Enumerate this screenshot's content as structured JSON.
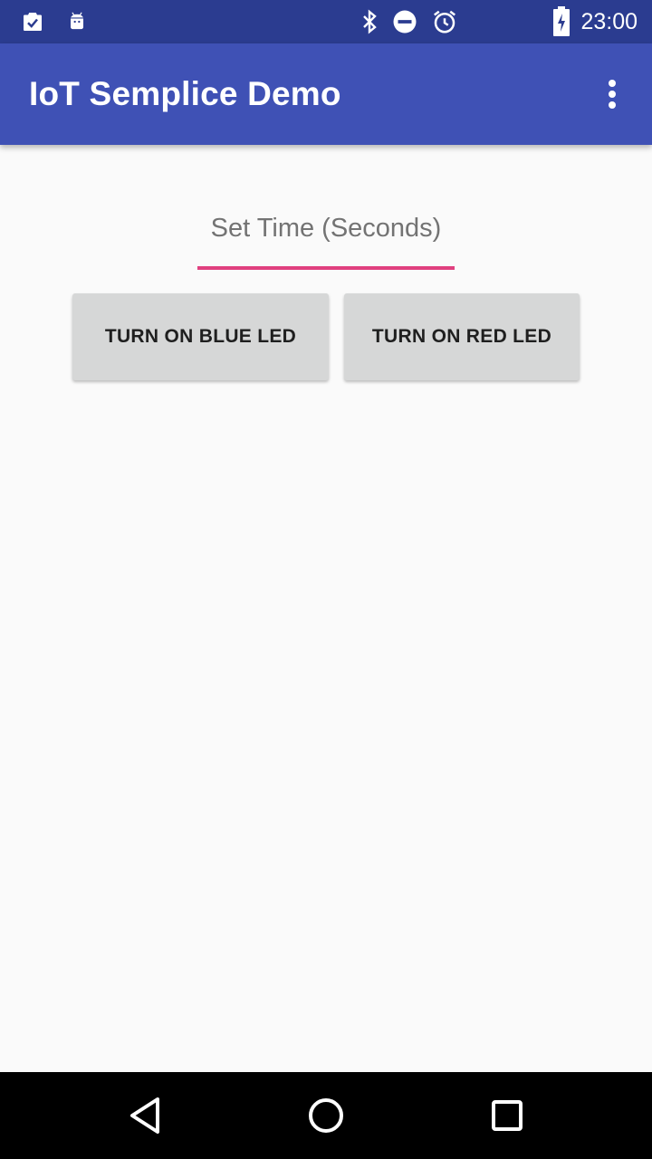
{
  "status_bar": {
    "time": "23:00",
    "left_icons": [
      "clipboard-check-icon",
      "android-icon"
    ],
    "right_icons": [
      "bluetooth-icon",
      "do-not-disturb-icon",
      "alarm-icon",
      "battery-charging-icon"
    ]
  },
  "app_bar": {
    "title": "IoT Semplice Demo",
    "color": "#3f51b5",
    "overflow_icon": "more-vert-icon"
  },
  "time_input": {
    "placeholder": "Set Time (Seconds)",
    "value": "",
    "accent_color": "#e0407f"
  },
  "buttons": {
    "blue_led": "TURN ON BLUE LED",
    "red_led": "TURN ON RED LED"
  },
  "nav_bar": {
    "icons": [
      "back-icon",
      "home-icon",
      "recents-icon"
    ]
  }
}
